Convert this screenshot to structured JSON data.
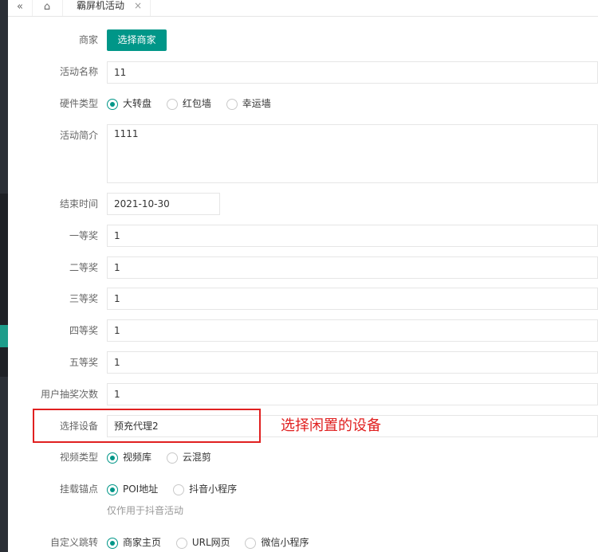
{
  "tabbar": {
    "back_glyph": "«",
    "home_glyph": "⌂",
    "tab_label": "霸屏机活动",
    "close_glyph": "×"
  },
  "form": {
    "merchant": {
      "label": "商家",
      "button": "选择商家"
    },
    "activity_name": {
      "label": "活动名称",
      "value": "11"
    },
    "hardware_type": {
      "label": "硬件类型",
      "options": [
        "大转盘",
        "红包墙",
        "幸运墙"
      ],
      "selected": "大转盘"
    },
    "intro": {
      "label": "活动简介",
      "value": "1111"
    },
    "end_time": {
      "label": "结束时间",
      "value": "2021-10-30"
    },
    "prize1": {
      "label": "一等奖",
      "value": "1"
    },
    "prize2": {
      "label": "二等奖",
      "value": "1"
    },
    "prize3": {
      "label": "三等奖",
      "value": "1"
    },
    "prize4": {
      "label": "四等奖",
      "value": "1"
    },
    "prize5": {
      "label": "五等奖",
      "value": "1"
    },
    "draw_times": {
      "label": "用户抽奖次数",
      "value": "1"
    },
    "device": {
      "label": "选择设备",
      "value": "预充代理2"
    },
    "video_type": {
      "label": "视频类型",
      "options": [
        "视频库",
        "云混剪"
      ],
      "selected": "视频库"
    },
    "anchor": {
      "label": "挂载锚点",
      "options": [
        "POI地址",
        "抖音小程序"
      ],
      "selected": "POI地址",
      "hint": "仅作用于抖音活动"
    },
    "redirect": {
      "label": "自定义跳转",
      "options": [
        "商家主页",
        "URL网页",
        "微信小程序"
      ],
      "selected": "商家主页"
    }
  },
  "annotation": {
    "text": "选择闲置的设备",
    "color": "#e02020"
  },
  "colors": {
    "accent": "#009688",
    "sidebar": "#2b2f36"
  }
}
